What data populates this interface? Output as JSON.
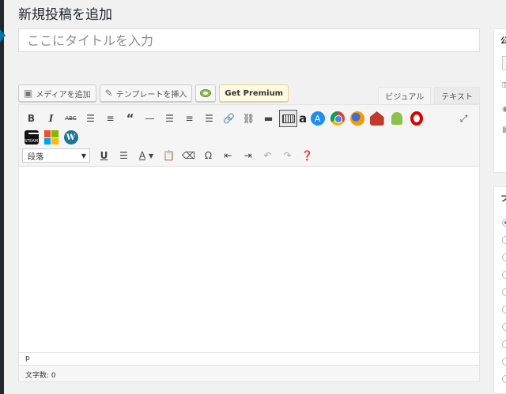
{
  "page": {
    "title": "新規投稿を追加"
  },
  "title_field": {
    "placeholder": "ここにタイトルを入力",
    "value": ""
  },
  "media_buttons": {
    "add_media": "メディアを追加",
    "insert_template": "テンプレートを挿入",
    "premium": "Get Premium"
  },
  "editor_tabs": {
    "visual": "ビジュアル",
    "text": "テキスト",
    "active": "visual"
  },
  "toolbar": {
    "format_select": "段落",
    "row1": [
      "bold-icon",
      "italic-icon",
      "strikethrough-icon",
      "bullet-list-icon",
      "numbered-list-icon",
      "blockquote-icon",
      "horizontal-rule-icon",
      "align-left-icon",
      "align-center-icon",
      "align-right-icon",
      "link-icon",
      "unlink-icon",
      "read-more-icon",
      "toolbar-toggle-icon",
      "amazon-icon",
      "appstore-icon",
      "chrome-icon",
      "firefox-icon",
      "fire-icon",
      "android-icon",
      "opera-icon",
      "fullscreen-icon"
    ],
    "row2": [
      "steam-icon",
      "microsoft-icon",
      "wordpress-icon"
    ],
    "row3": [
      "underline-icon",
      "justify-icon",
      "text-color-icon",
      "paste-text-icon",
      "clear-formatting-icon",
      "special-character-icon",
      "outdent-icon",
      "indent-icon",
      "undo-icon",
      "redo-icon",
      "help-icon"
    ]
  },
  "status": {
    "path": "p",
    "word_count": "文字数: 0"
  },
  "sidebar": {
    "publish_head": "公",
    "format_head": "フ"
  },
  "colors": {
    "accent": "#0073aa",
    "admin_bar": "#23282d",
    "premium_bg": "#fffbe0"
  }
}
